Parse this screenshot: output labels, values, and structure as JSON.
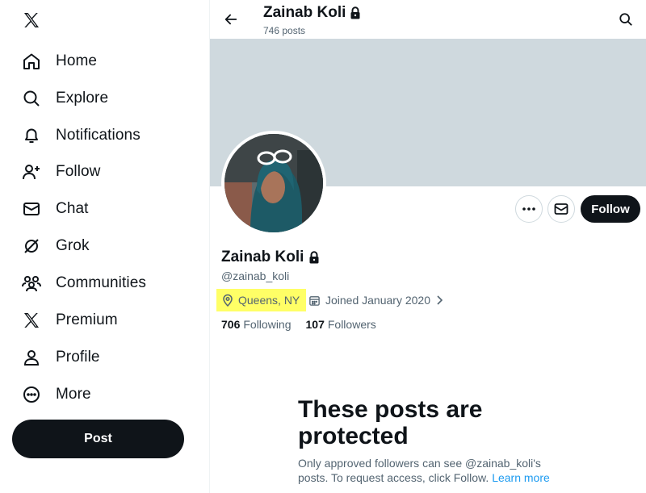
{
  "sidebar": {
    "logo": "x-logo-icon",
    "items": [
      {
        "label": "Home",
        "icon": "home-icon"
      },
      {
        "label": "Explore",
        "icon": "search-icon"
      },
      {
        "label": "Notifications",
        "icon": "bell-icon"
      },
      {
        "label": "Follow",
        "icon": "person-plus-icon"
      },
      {
        "label": "Chat",
        "icon": "mail-icon"
      },
      {
        "label": "Grok",
        "icon": "grok-icon"
      },
      {
        "label": "Communities",
        "icon": "communities-icon"
      },
      {
        "label": "Premium",
        "icon": "x-premium-icon"
      },
      {
        "label": "Profile",
        "icon": "person-icon"
      },
      {
        "label": "More",
        "icon": "more-circle-icon"
      }
    ],
    "post_label": "Post"
  },
  "header": {
    "name": "Zainab Koli",
    "posts_count": "746 posts"
  },
  "profile": {
    "display_name": "Zainab Koli",
    "handle": "@zainab_koli",
    "location": "Queens, NY",
    "joined": "Joined January 2020",
    "following_count": "706",
    "following_label": "Following",
    "followers_count": "107",
    "followers_label": "Followers",
    "follow_label": "Follow"
  },
  "protected": {
    "title": "These posts are protected",
    "text": "Only approved followers can see @zainab_koli's posts. To request access, click Follow.",
    "link": "Learn more"
  },
  "colors": {
    "text": "#0f1419",
    "secondary": "#536471",
    "banner": "#cfd9de",
    "highlight": "#ffff66",
    "link": "#1d9bf0"
  }
}
